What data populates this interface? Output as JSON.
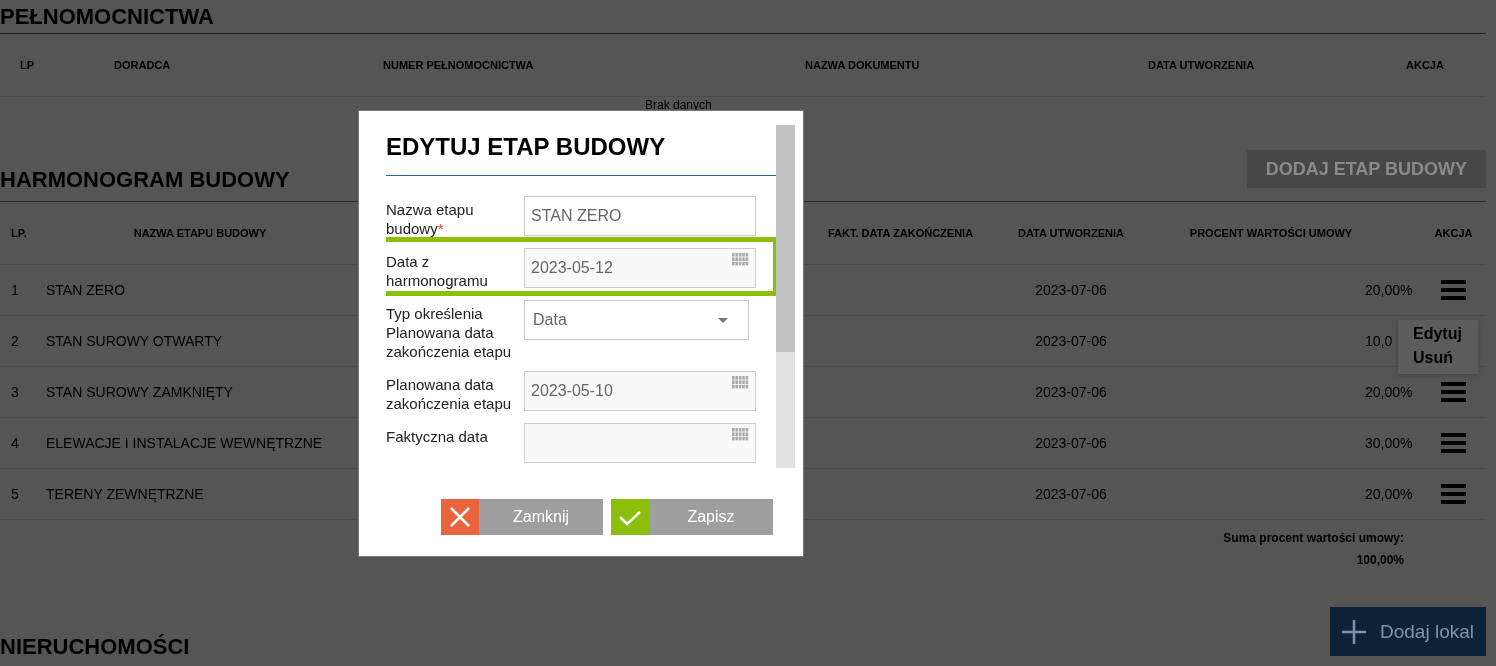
{
  "power_of_attorney": {
    "title": "PEŁNOMOCNICTWA",
    "columns": [
      "LP",
      "DORADCA",
      "NUMER PEŁNOMOCNICTWA",
      "NAZWA DOKUMENTU",
      "DATA UTWORZENIA",
      "AKCJA"
    ],
    "empty_text": "Brak danych"
  },
  "schedule": {
    "title": "HARMONOGRAM BUDOWY",
    "add_button": "DODAJ ETAP BUDOWY",
    "columns": [
      "LP.",
      "NAZWA ETAPU BUDOWY",
      "FAKT. DATA ZAKOŃCZENIA",
      "DATA UTWORZENIA",
      "PROCENT WARTOŚCI UMOWY",
      "AKCJA"
    ],
    "rows": [
      {
        "lp": "1",
        "name": "STAN ZERO",
        "created": "2023-07-06",
        "percent": "20,00%",
        "action_icon": true
      },
      {
        "lp": "2",
        "name": "STAN SUROWY OTWARTY",
        "created": "2023-07-06",
        "percent": "10,0",
        "action_icon": false
      },
      {
        "lp": "3",
        "name": "STAN SUROWY ZAMKNIĘTY",
        "created": "2023-07-06",
        "percent": "20,00%",
        "action_icon": true
      },
      {
        "lp": "4",
        "name": "ELEWACJE I INSTALACJE WEWNĘTRZNE",
        "created": "2023-07-06",
        "percent": "30,00%",
        "action_icon": true
      },
      {
        "lp": "5",
        "name": "TERENY ZEWNĘTRZNE",
        "created": "2023-07-06",
        "percent": "20,00%",
        "action_icon": true
      }
    ],
    "sum_label": "Suma procent wartości umowy:",
    "sum_value": "100,00%"
  },
  "action_menu": {
    "items": [
      "Edytuj",
      "Usuń"
    ]
  },
  "properties": {
    "title": "NIERUCHOMOŚCI",
    "add_button": "Dodaj lokal"
  },
  "modal": {
    "title": "EDYTUJ ETAP BUDOWY",
    "fields": [
      {
        "kind": "text",
        "label": "Nazwa etapu budowy",
        "required_mark": "*",
        "highlighted": false,
        "value": "STAN ZERO"
      },
      {
        "kind": "date",
        "label": "Data z harmonogramu",
        "highlighted": true,
        "value": "2023-05-12"
      },
      {
        "kind": "select",
        "label": "Typ określenia Planowana data zakończenia etapu",
        "highlighted": false,
        "value": "Data"
      },
      {
        "kind": "date",
        "label": "Planowana data zakończenia etapu",
        "highlighted": false,
        "value": "2023-05-10"
      },
      {
        "kind": "date",
        "label": "Faktyczna data",
        "highlighted": false
      }
    ],
    "buttons": [
      {
        "kind": "close",
        "label": "Zamknij"
      },
      {
        "kind": "save",
        "label": "Zapisz"
      }
    ]
  }
}
